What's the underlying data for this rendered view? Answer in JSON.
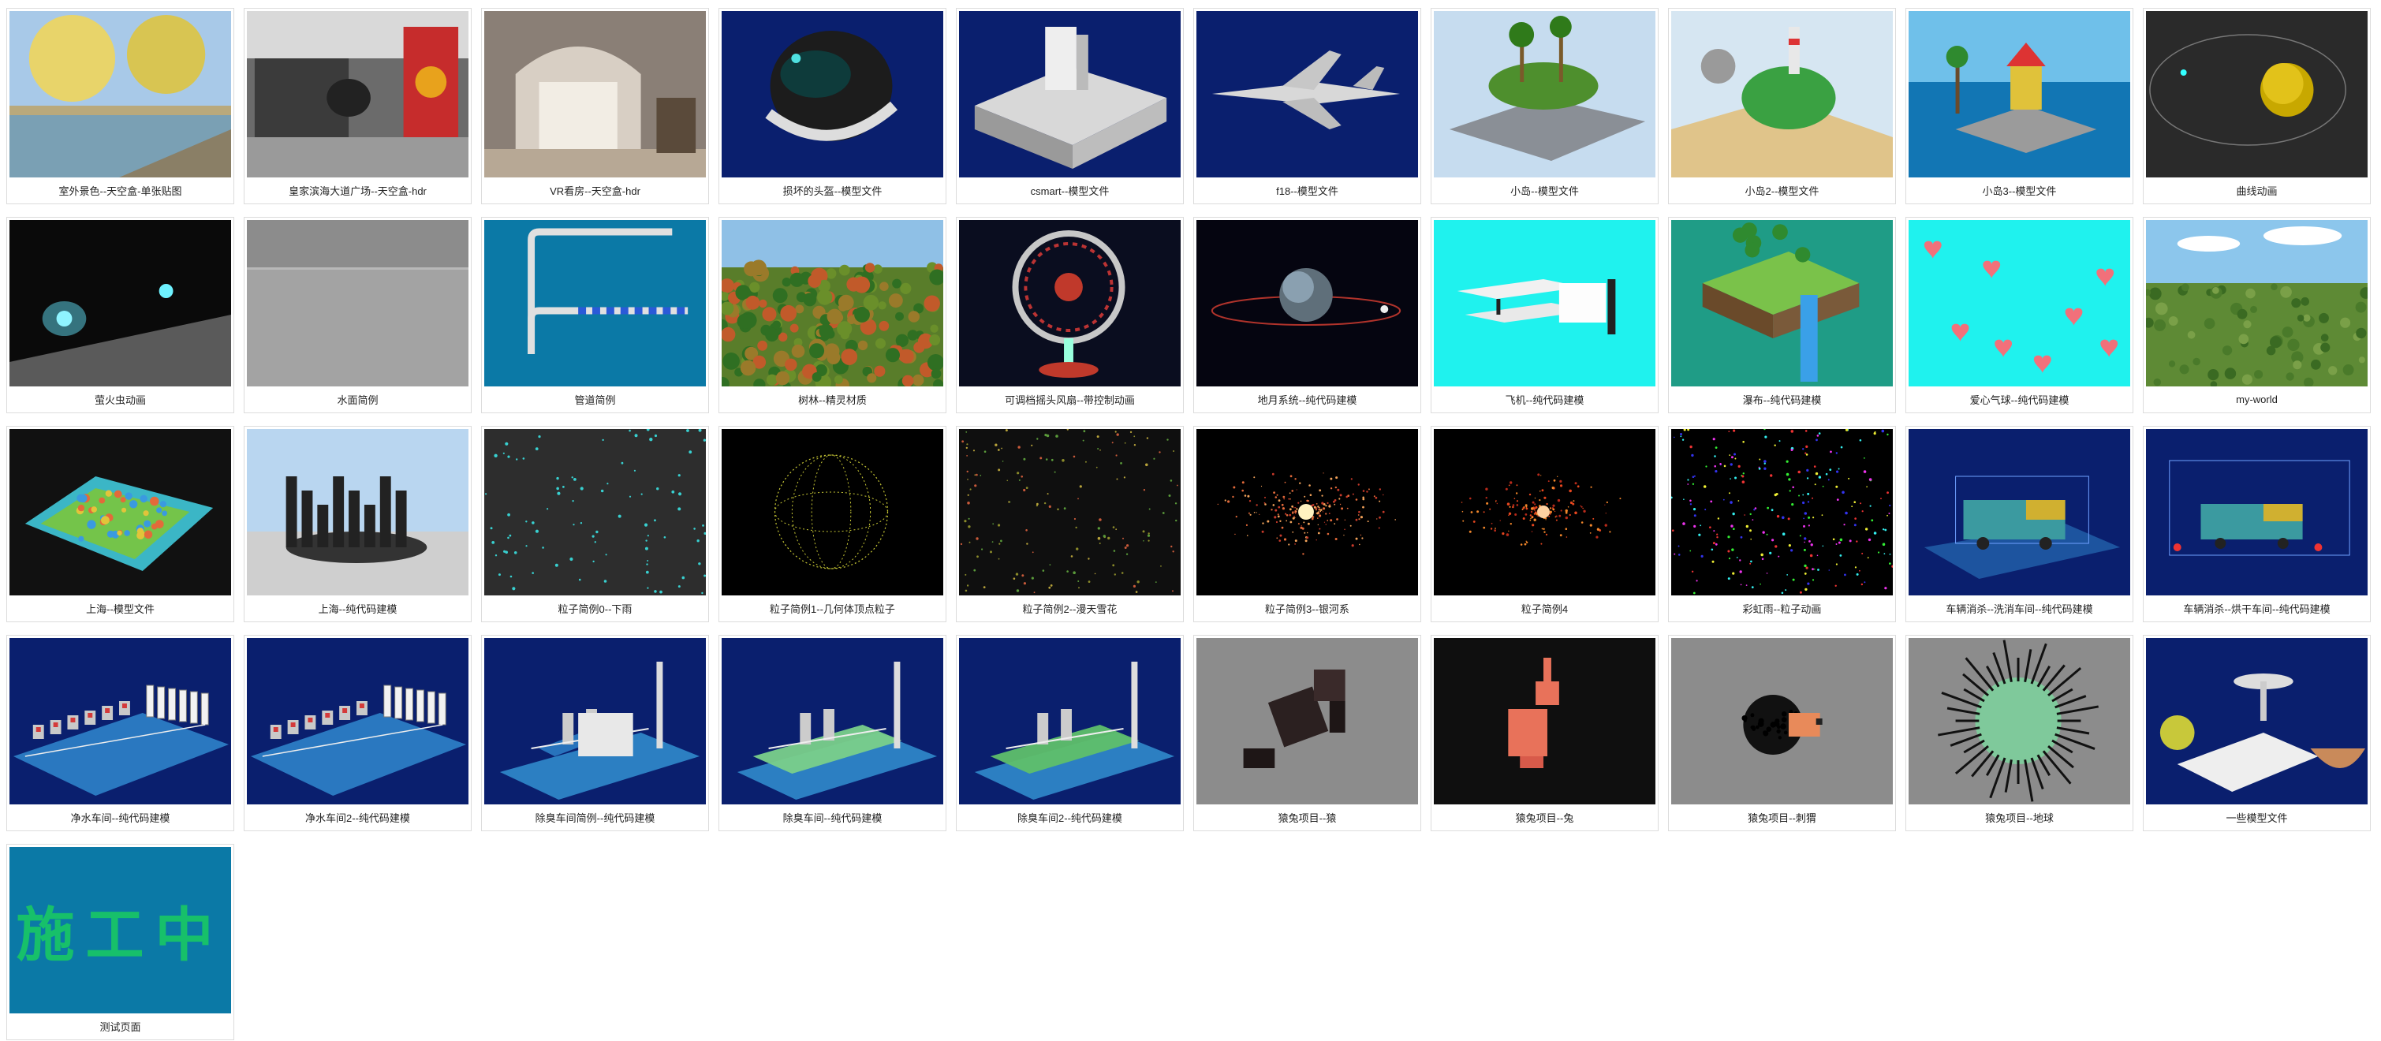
{
  "gallery": {
    "items": [
      {
        "caption": "室外景色--天空盒-单张贴图",
        "scene": "outdoor-canal-photo"
      },
      {
        "caption": "皇家滨海大道广场--天空盒-hdr",
        "scene": "plaza-interior-hdr"
      },
      {
        "caption": "VR看房--天空盒-hdr",
        "scene": "house-interior-hdr"
      },
      {
        "caption": "损坏的头盔--模型文件",
        "scene": "damaged-helmet"
      },
      {
        "caption": "csmart--模型文件",
        "scene": "building-block-model"
      },
      {
        "caption": "f18--模型文件",
        "scene": "fighter-jet"
      },
      {
        "caption": "小岛--模型文件",
        "scene": "floating-island"
      },
      {
        "caption": "小岛2--模型文件",
        "scene": "island-lighthouse"
      },
      {
        "caption": "小岛3--模型文件",
        "scene": "island-sea"
      },
      {
        "caption": "曲线动画",
        "scene": "curve-orbit-sphere"
      },
      {
        "caption": "萤火虫动画",
        "scene": "firefly-glow"
      },
      {
        "caption": "水面简例",
        "scene": "water-plane"
      },
      {
        "caption": "管道简例",
        "scene": "pipe-bend"
      },
      {
        "caption": "树林--精灵材质",
        "scene": "forest-sprites"
      },
      {
        "caption": "可调档摇头风扇--带控制动画",
        "scene": "electric-fan"
      },
      {
        "caption": "地月系统--纯代码建模",
        "scene": "earth-moon"
      },
      {
        "caption": "飞机--纯代码建模",
        "scene": "biplane"
      },
      {
        "caption": "瀑布--纯代码建模",
        "scene": "waterfall-block"
      },
      {
        "caption": "爱心气球--纯代码建模",
        "scene": "heart-balloons"
      },
      {
        "caption": "my-world",
        "scene": "voxel-world"
      },
      {
        "caption": "上海--模型文件",
        "scene": "shanghai-map"
      },
      {
        "caption": "上海--纯代码建模",
        "scene": "shanghai-towers"
      },
      {
        "caption": "粒子简例0--下雨",
        "scene": "particle-rain"
      },
      {
        "caption": "粒子简例1--几何体顶点粒子",
        "scene": "particle-sphere"
      },
      {
        "caption": "粒子简例2--漫天雪花",
        "scene": "particle-snow"
      },
      {
        "caption": "粒子简例3--银河系",
        "scene": "particle-galaxy"
      },
      {
        "caption": "粒子简例4",
        "scene": "particle-flare"
      },
      {
        "caption": "彩虹雨--粒子动画",
        "scene": "rainbow-particles"
      },
      {
        "caption": "车辆消杀--洗消车间--纯代码建模",
        "scene": "vehicle-wash"
      },
      {
        "caption": "车辆消杀--烘干车间--纯代码建模",
        "scene": "vehicle-dry"
      },
      {
        "caption": "净水车间--纯代码建模",
        "scene": "water-plant-1"
      },
      {
        "caption": "净水车间2--纯代码建模",
        "scene": "water-plant-2"
      },
      {
        "caption": "除臭车间简例--纯代码建模",
        "scene": "deodor-simple"
      },
      {
        "caption": "除臭车间--纯代码建模",
        "scene": "deodor-plant-1"
      },
      {
        "caption": "除臭车间2--纯代码建模",
        "scene": "deodor-plant-2"
      },
      {
        "caption": "猿兔项目--猿",
        "scene": "voxel-ape"
      },
      {
        "caption": "猿兔项目--兔",
        "scene": "voxel-rabbit"
      },
      {
        "caption": "猿兔项目--刺猬",
        "scene": "voxel-hedgehog"
      },
      {
        "caption": "猿兔项目--地球",
        "scene": "spiky-globe"
      },
      {
        "caption": "一些模型文件",
        "scene": "model-collection"
      },
      {
        "caption": "测试页面",
        "scene": "under-construction",
        "overlay": "施工中"
      }
    ]
  },
  "colors": {
    "navy": "#0a1f6e",
    "navy2": "#06195f",
    "teal": "#0b79a6",
    "cyan": "#1ff2ee",
    "black": "#0d0d0d",
    "gray": "#8e8e8e",
    "wipGreen": "#17c06a"
  }
}
